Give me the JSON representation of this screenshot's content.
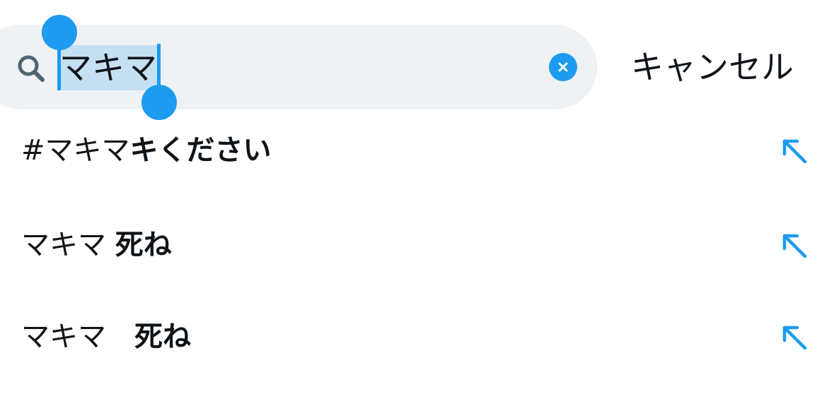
{
  "search": {
    "query": "マキマ",
    "selected_text": "マキマ"
  },
  "cancel_label": "キャンセル",
  "suggestions": [
    {
      "prefix": "#マキマ",
      "completion": "キください"
    },
    {
      "prefix": "マキマ ",
      "completion": "死ね"
    },
    {
      "prefix": "マキマ　",
      "completion": "死ね"
    }
  ],
  "icons": {
    "search": "search-icon",
    "clear": "clear-icon",
    "insert": "arrow-up-left-icon"
  },
  "colors": {
    "accent": "#1d9bf0",
    "search_bg": "#eef2f4",
    "selection": "#c6e0f3",
    "text": "#0f1419"
  }
}
